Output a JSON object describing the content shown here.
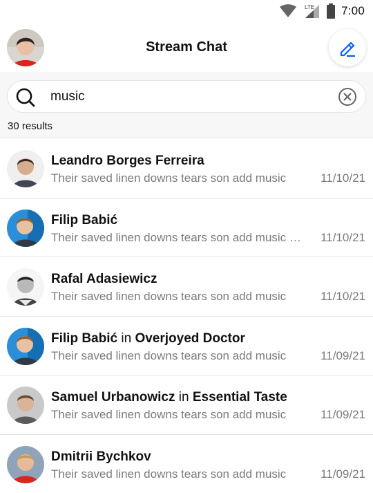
{
  "status_bar": {
    "time": "7:00",
    "network_label": "LTE"
  },
  "header": {
    "title": "Stream Chat"
  },
  "search": {
    "value": "music",
    "placeholder": "Search"
  },
  "results": {
    "count_label": "30 results"
  },
  "conversations": [
    {
      "name": "Leandro Borges Ferreira",
      "in_label": "",
      "channel": "",
      "preview": "Their saved linen downs tears son add music",
      "date": "11/10/21"
    },
    {
      "name": "Filip Babić",
      "in_label": "",
      "channel": "",
      "preview": "Their saved linen downs tears son add music h...",
      "date": "11/10/21"
    },
    {
      "name": "Rafal Adasiewicz",
      "in_label": "",
      "channel": "",
      "preview": "Their saved linen downs tears son add music",
      "date": "11/10/21"
    },
    {
      "name": "Filip Babić",
      "in_label": "in",
      "channel": "Overjoyed Doctor",
      "preview": "Their saved linen downs tears son add music",
      "date": "11/09/21"
    },
    {
      "name": "Samuel Urbanowicz",
      "in_label": "in",
      "channel": "Essential Taste",
      "preview": "Their saved linen downs tears son add music",
      "date": "11/09/21"
    },
    {
      "name": "Dmitrii Bychkov",
      "in_label": "",
      "channel": "",
      "preview": "Their saved linen downs tears son add music",
      "date": "11/09/21"
    }
  ],
  "colors": {
    "accent": "#005fff",
    "secondary_text": "#7a7a7a",
    "search_bg": "#f7f7f7"
  },
  "icons": [
    "wifi-icon",
    "cell-signal-icon",
    "battery-icon",
    "compose-icon",
    "search-icon",
    "clear-icon"
  ]
}
